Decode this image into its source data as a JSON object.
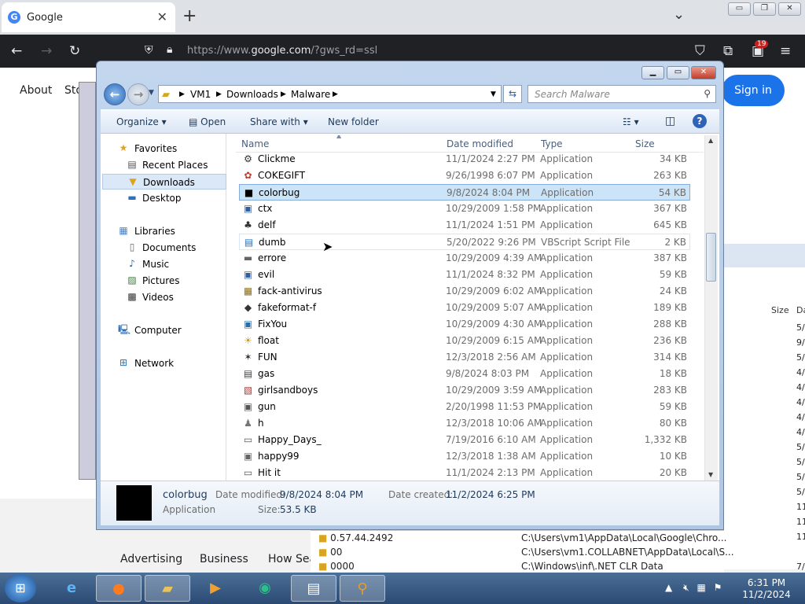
{
  "browser": {
    "tab_title": "Google",
    "url_prefix": "https://www.",
    "url_domain": "google.com",
    "url_suffix": "/?gws_rd=ssl",
    "badge_count": "19"
  },
  "google": {
    "about": "About",
    "store_partial": "Sto",
    "signin": "Sign in",
    "footer": [
      "Advertising",
      "Business",
      "How Sea"
    ]
  },
  "background_window": {
    "size_header": "Size",
    "date_header_partial": "Da",
    "date_partials": [
      "5/",
      "9/",
      "5/",
      "4/",
      "4/",
      "4/",
      "4/",
      "4/",
      "5/",
      "5/",
      "5/",
      "5/",
      "11",
      "11",
      "11",
      "7/"
    ],
    "rows": [
      {
        "name": "0.57.44.2492",
        "path": "C:\\Users\\vm1\\AppData\\Local\\Google\\Chro..."
      },
      {
        "name": "00",
        "path": "C:\\Users\\vm1.COLLABNET\\AppData\\Local\\S..."
      },
      {
        "name": "0000",
        "path": "C:\\Windows\\inf\\.NET CLR Data"
      }
    ]
  },
  "explorer": {
    "breadcrumb": [
      "VM1",
      "Downloads",
      "Malware"
    ],
    "search_placeholder": "Search Malware",
    "commands": {
      "organize": "Organize",
      "open": "Open",
      "share": "Share with",
      "new_folder": "New folder"
    },
    "nav": {
      "favorites": "Favorites",
      "recent": "Recent Places",
      "downloads": "Downloads",
      "desktop": "Desktop",
      "libraries": "Libraries",
      "documents": "Documents",
      "music": "Music",
      "pictures": "Pictures",
      "videos": "Videos",
      "computer": "Computer",
      "network": "Network"
    },
    "columns": {
      "name": "Name",
      "date": "Date modified",
      "type": "Type",
      "size": "Size"
    },
    "files": [
      {
        "name": "Clickme",
        "date": "11/1/2024 2:27 PM",
        "type": "Application",
        "size": "34 KB"
      },
      {
        "name": "COKEGIFT",
        "date": "9/26/1998 6:07 PM",
        "type": "Application",
        "size": "263 KB"
      },
      {
        "name": "colorbug",
        "date": "9/8/2024 8:04 PM",
        "type": "Application",
        "size": "54 KB"
      },
      {
        "name": "ctx",
        "date": "10/29/2009 1:58 PM",
        "type": "Application",
        "size": "367 KB"
      },
      {
        "name": "delf",
        "date": "11/1/2024 1:51 PM",
        "type": "Application",
        "size": "645 KB"
      },
      {
        "name": "dumb",
        "date": "5/20/2022 9:26 PM",
        "type": "VBScript Script File",
        "size": "2 KB"
      },
      {
        "name": "errore",
        "date": "10/29/2009 4:39 AM",
        "type": "Application",
        "size": "387 KB"
      },
      {
        "name": "evil",
        "date": "11/1/2024 8:32 PM",
        "type": "Application",
        "size": "59 KB"
      },
      {
        "name": "fack-antivirus",
        "date": "10/29/2009 6:02 AM",
        "type": "Application",
        "size": "24 KB"
      },
      {
        "name": "fakeformat-f",
        "date": "10/29/2009 5:07 AM",
        "type": "Application",
        "size": "189 KB"
      },
      {
        "name": "FixYou",
        "date": "10/29/2009 4:30 AM",
        "type": "Application",
        "size": "288 KB"
      },
      {
        "name": "float",
        "date": "10/29/2009 6:15 AM",
        "type": "Application",
        "size": "236 KB"
      },
      {
        "name": "FUN",
        "date": "12/3/2018 2:56 AM",
        "type": "Application",
        "size": "314 KB"
      },
      {
        "name": "gas",
        "date": "9/8/2024 8:03 PM",
        "type": "Application",
        "size": "18 KB"
      },
      {
        "name": "girlsandboys",
        "date": "10/29/2009 3:59 AM",
        "type": "Application",
        "size": "283 KB"
      },
      {
        "name": "gun",
        "date": "2/20/1998 11:53 PM",
        "type": "Application",
        "size": "59 KB"
      },
      {
        "name": "h",
        "date": "12/3/2018 10:06 AM",
        "type": "Application",
        "size": "80 KB"
      },
      {
        "name": "Happy_Days_",
        "date": "7/19/2016 6:10 AM",
        "type": "Application",
        "size": "1,332 KB"
      },
      {
        "name": "happy99",
        "date": "12/3/2018 1:38 AM",
        "type": "Application",
        "size": "10 KB"
      },
      {
        "name": "Hit it",
        "date": "11/1/2024 2:13 PM",
        "type": "Application",
        "size": "20 KB"
      }
    ],
    "details": {
      "name": "colorbug",
      "type": "Application",
      "modified_label": "Date modified:",
      "modified_value": "9/8/2024 8:04 PM",
      "size_label": "Size:",
      "size_value": "53.5 KB",
      "created_label": "Date created:",
      "created_value": "11/2/2024 6:25 PM"
    }
  },
  "taskbar": {
    "time": "6:31 PM",
    "date": "11/2/2024"
  }
}
